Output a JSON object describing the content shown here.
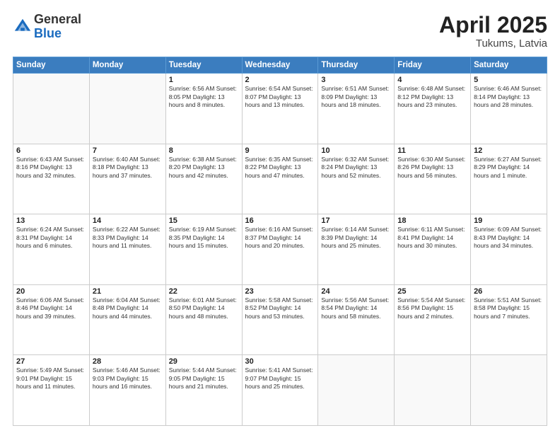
{
  "logo": {
    "general": "General",
    "blue": "Blue"
  },
  "title": {
    "month_year": "April 2025",
    "location": "Tukums, Latvia"
  },
  "weekdays": [
    "Sunday",
    "Monday",
    "Tuesday",
    "Wednesday",
    "Thursday",
    "Friday",
    "Saturday"
  ],
  "weeks": [
    [
      {
        "day": "",
        "info": ""
      },
      {
        "day": "",
        "info": ""
      },
      {
        "day": "1",
        "info": "Sunrise: 6:56 AM\nSunset: 8:05 PM\nDaylight: 13 hours and 8 minutes."
      },
      {
        "day": "2",
        "info": "Sunrise: 6:54 AM\nSunset: 8:07 PM\nDaylight: 13 hours and 13 minutes."
      },
      {
        "day": "3",
        "info": "Sunrise: 6:51 AM\nSunset: 8:09 PM\nDaylight: 13 hours and 18 minutes."
      },
      {
        "day": "4",
        "info": "Sunrise: 6:48 AM\nSunset: 8:12 PM\nDaylight: 13 hours and 23 minutes."
      },
      {
        "day": "5",
        "info": "Sunrise: 6:46 AM\nSunset: 8:14 PM\nDaylight: 13 hours and 28 minutes."
      }
    ],
    [
      {
        "day": "6",
        "info": "Sunrise: 6:43 AM\nSunset: 8:16 PM\nDaylight: 13 hours and 32 minutes."
      },
      {
        "day": "7",
        "info": "Sunrise: 6:40 AM\nSunset: 8:18 PM\nDaylight: 13 hours and 37 minutes."
      },
      {
        "day": "8",
        "info": "Sunrise: 6:38 AM\nSunset: 8:20 PM\nDaylight: 13 hours and 42 minutes."
      },
      {
        "day": "9",
        "info": "Sunrise: 6:35 AM\nSunset: 8:22 PM\nDaylight: 13 hours and 47 minutes."
      },
      {
        "day": "10",
        "info": "Sunrise: 6:32 AM\nSunset: 8:24 PM\nDaylight: 13 hours and 52 minutes."
      },
      {
        "day": "11",
        "info": "Sunrise: 6:30 AM\nSunset: 8:26 PM\nDaylight: 13 hours and 56 minutes."
      },
      {
        "day": "12",
        "info": "Sunrise: 6:27 AM\nSunset: 8:29 PM\nDaylight: 14 hours and 1 minute."
      }
    ],
    [
      {
        "day": "13",
        "info": "Sunrise: 6:24 AM\nSunset: 8:31 PM\nDaylight: 14 hours and 6 minutes."
      },
      {
        "day": "14",
        "info": "Sunrise: 6:22 AM\nSunset: 8:33 PM\nDaylight: 14 hours and 11 minutes."
      },
      {
        "day": "15",
        "info": "Sunrise: 6:19 AM\nSunset: 8:35 PM\nDaylight: 14 hours and 15 minutes."
      },
      {
        "day": "16",
        "info": "Sunrise: 6:16 AM\nSunset: 8:37 PM\nDaylight: 14 hours and 20 minutes."
      },
      {
        "day": "17",
        "info": "Sunrise: 6:14 AM\nSunset: 8:39 PM\nDaylight: 14 hours and 25 minutes."
      },
      {
        "day": "18",
        "info": "Sunrise: 6:11 AM\nSunset: 8:41 PM\nDaylight: 14 hours and 30 minutes."
      },
      {
        "day": "19",
        "info": "Sunrise: 6:09 AM\nSunset: 8:43 PM\nDaylight: 14 hours and 34 minutes."
      }
    ],
    [
      {
        "day": "20",
        "info": "Sunrise: 6:06 AM\nSunset: 8:46 PM\nDaylight: 14 hours and 39 minutes."
      },
      {
        "day": "21",
        "info": "Sunrise: 6:04 AM\nSunset: 8:48 PM\nDaylight: 14 hours and 44 minutes."
      },
      {
        "day": "22",
        "info": "Sunrise: 6:01 AM\nSunset: 8:50 PM\nDaylight: 14 hours and 48 minutes."
      },
      {
        "day": "23",
        "info": "Sunrise: 5:58 AM\nSunset: 8:52 PM\nDaylight: 14 hours and 53 minutes."
      },
      {
        "day": "24",
        "info": "Sunrise: 5:56 AM\nSunset: 8:54 PM\nDaylight: 14 hours and 58 minutes."
      },
      {
        "day": "25",
        "info": "Sunrise: 5:54 AM\nSunset: 8:56 PM\nDaylight: 15 hours and 2 minutes."
      },
      {
        "day": "26",
        "info": "Sunrise: 5:51 AM\nSunset: 8:58 PM\nDaylight: 15 hours and 7 minutes."
      }
    ],
    [
      {
        "day": "27",
        "info": "Sunrise: 5:49 AM\nSunset: 9:01 PM\nDaylight: 15 hours and 11 minutes."
      },
      {
        "day": "28",
        "info": "Sunrise: 5:46 AM\nSunset: 9:03 PM\nDaylight: 15 hours and 16 minutes."
      },
      {
        "day": "29",
        "info": "Sunrise: 5:44 AM\nSunset: 9:05 PM\nDaylight: 15 hours and 21 minutes."
      },
      {
        "day": "30",
        "info": "Sunrise: 5:41 AM\nSunset: 9:07 PM\nDaylight: 15 hours and 25 minutes."
      },
      {
        "day": "",
        "info": ""
      },
      {
        "day": "",
        "info": ""
      },
      {
        "day": "",
        "info": ""
      }
    ]
  ]
}
